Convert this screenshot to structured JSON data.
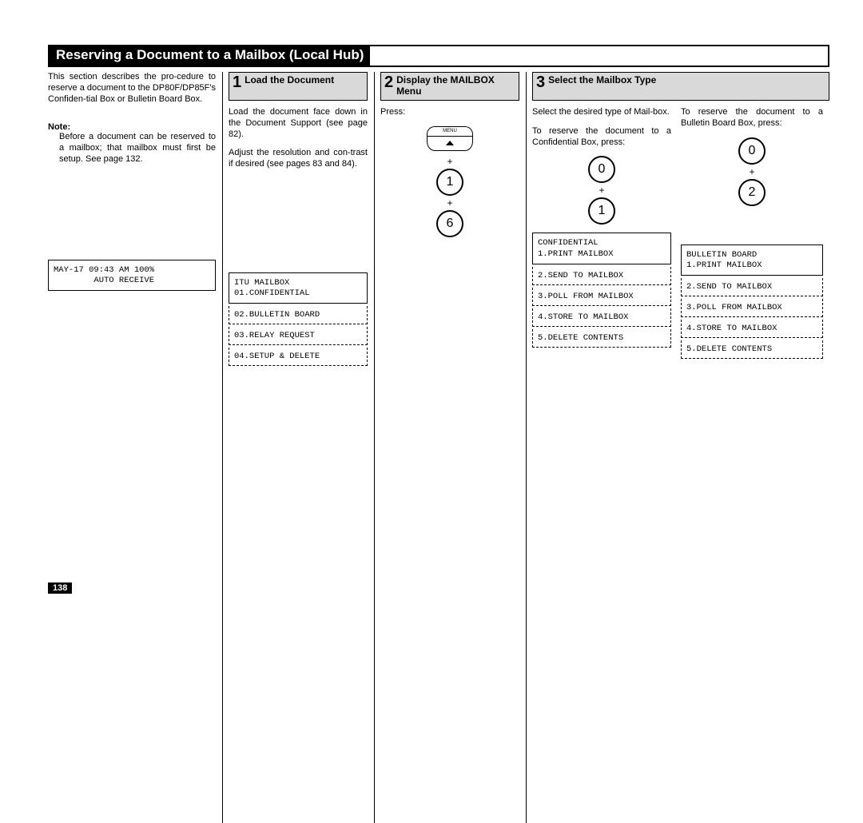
{
  "title": "Reserving a Document to a Mailbox (Local Hub)",
  "intro_text": "This section describes the pro-cedure to reserve a document to the DP80F/DP85F's Confiden-tial Box or Bulletin Board Box.",
  "note_label": "Note:",
  "note_text": "Before a document can be reserved to a mailbox; that mailbox must first be setup. See page 132.",
  "step1": {
    "num": "1",
    "title": "Load the Document",
    "body1": "Load the document face down in the Document Support (see page 82).",
    "body2": "Adjust the resolution and con-trast if desired (see pages 83 and 84).",
    "lcd_line1": "MAY-17 09:43 AM 100%",
    "lcd_line2": "        AUTO RECEIVE"
  },
  "step2": {
    "num": "2",
    "title": "Display the MAILBOX Menu",
    "press_label": "Press:",
    "menu_label": "MENU",
    "key1": "1",
    "key2": "6",
    "lcd_line1": "ITU MAILBOX",
    "lcd_line2": "01.CONFIDENTIAL",
    "scroll": [
      "02.BULLETIN BOARD",
      "03.RELAY REQUEST",
      "04.SETUP & DELETE"
    ]
  },
  "step3": {
    "num": "3",
    "title": "Select the Mailbox Type",
    "a": {
      "body1": "Select the desired type of Mail-box.",
      "body2": "To reserve the document to a Confidential Box, press:",
      "key1": "0",
      "key2": "1",
      "lcd_line1": "CONFIDENTIAL",
      "lcd_line2": "1.PRINT MAILBOX",
      "scroll": [
        "2.SEND TO MAILBOX",
        "3.POLL FROM MAILBOX",
        "4.STORE TO MAILBOX",
        "5.DELETE CONTENTS"
      ]
    },
    "b": {
      "body1": "To reserve the document to a Bulletin Board Box, press:",
      "key1": "0",
      "key2": "2",
      "lcd_line1": "BULLETIN BOARD",
      "lcd_line2": "1.PRINT MAILBOX",
      "scroll": [
        "2.SEND TO MAILBOX",
        "3.POLL FROM MAILBOX",
        "4.STORE TO MAILBOX",
        "5.DELETE CONTENTS"
      ]
    }
  },
  "plus": "+",
  "page_number": "138"
}
